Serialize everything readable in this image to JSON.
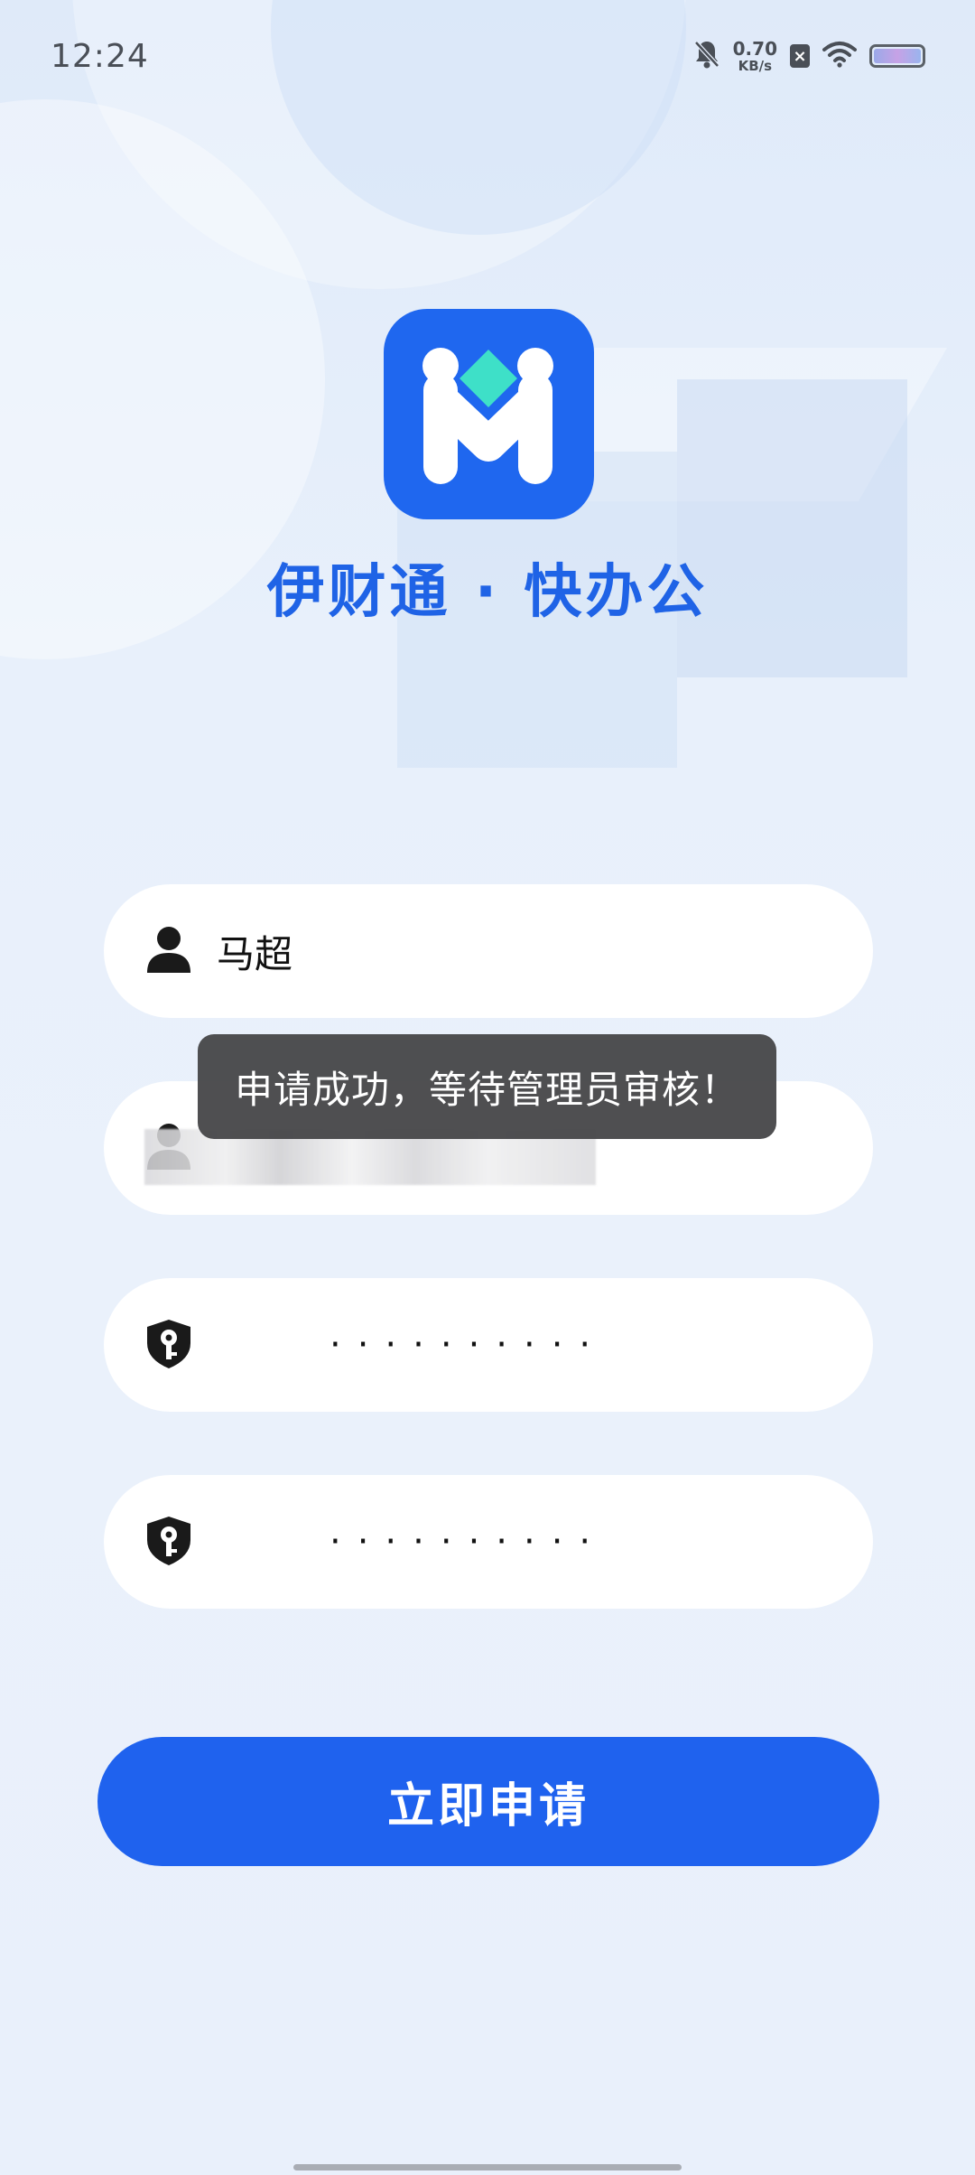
{
  "status_bar": {
    "time": "12:24",
    "net_speed_value": "0.70",
    "net_speed_unit": "KB/s",
    "icons": [
      "bell-muted-icon",
      "sim-x-icon",
      "wifi-icon",
      "battery-icon"
    ]
  },
  "app": {
    "title": "伊财通 · 快办公",
    "logo_icon": "app-logo-icon",
    "brand_color": "#1f67ef"
  },
  "form": {
    "name_value": "马超",
    "name_icon": "user-icon",
    "second_user_icon": "user-icon",
    "password_mask": "··········",
    "password_icon": "shield-key-icon",
    "confirm_password_mask": "··········",
    "confirm_password_icon": "shield-key-icon"
  },
  "toast": {
    "message": "申请成功，等待管理员审核！"
  },
  "submit_button": {
    "label": "立即申请",
    "color": "#1f62ee"
  }
}
